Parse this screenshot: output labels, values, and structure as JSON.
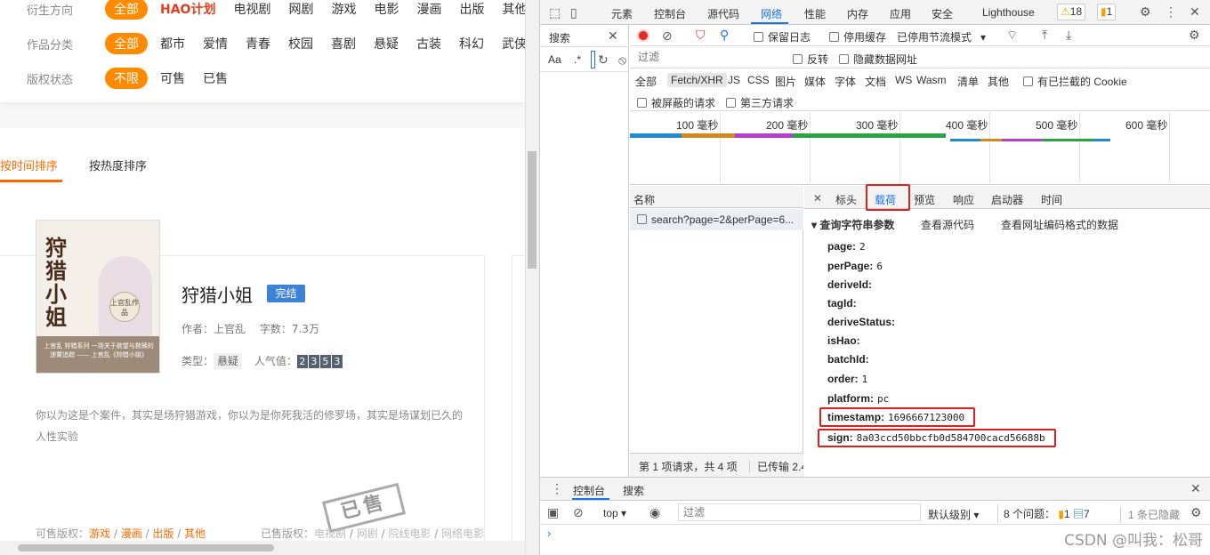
{
  "left": {
    "filters": [
      {
        "label": "衍生方向",
        "active": "全部",
        "hao": "HAO计划",
        "options": [
          "电视剧",
          "网剧",
          "游戏",
          "电影",
          "漫画",
          "出版",
          "其他"
        ]
      },
      {
        "label": "作品分类",
        "active": "全部",
        "options": [
          "都市",
          "爱情",
          "青春",
          "校园",
          "喜剧",
          "悬疑",
          "古装",
          "科幻",
          "武侠"
        ]
      },
      {
        "label": "版权状态",
        "active": "不限",
        "options": [
          "可售",
          "已售"
        ]
      }
    ],
    "sort": {
      "by_time": "按时间排序",
      "by_heat": "按热度排序"
    },
    "book": {
      "cover_title": "狩猎小姐",
      "cover_seal": "上官乱作品",
      "cover_band": "上官乱 狩猎系列 一场关于欲望与救赎的迷雾追踪 —— 上官乱《狩猎小姐》",
      "title": "狩猎小姐",
      "status": "完结",
      "author_label": "作者：",
      "author": "上官乱",
      "words_label": "字数：",
      "words": "7.3万",
      "type_label": "类型：",
      "type": "悬疑",
      "popularity_label": "人气值：",
      "popularity_digits": [
        "2",
        "3",
        "5",
        "3"
      ],
      "description": "你以为这是个案件，其实是场狩猎游戏，你以为是你死我活的修罗场，其实是场谋划已久的人性实验",
      "sellable_label": "可售版权：",
      "sellable": [
        "游戏",
        "漫画",
        "出版",
        "其他"
      ],
      "sold_label": "已售版权：",
      "sold": [
        "电视剧",
        "网剧",
        "院线电影",
        "网络电影"
      ],
      "stamp": "已售"
    }
  },
  "devtools": {
    "tabs": [
      "元素",
      "控制台",
      "源代码",
      "网络",
      "性能",
      "内存",
      "应用",
      "安全",
      "Lighthouse"
    ],
    "active_tab": "网络",
    "warnings": "18",
    "errors": "1",
    "search": {
      "title": "搜索",
      "aa": "Aa",
      "regex": ".*"
    },
    "toolbar": {
      "preserve_log": "保留日志",
      "disable_cache": "停用缓存",
      "throttle": "已停用节流模式"
    },
    "filter": {
      "placeholder": "过滤",
      "invert": "反转",
      "hide_data_urls": "隐藏数据网址"
    },
    "types": [
      "全部",
      "Fetch/XHR",
      "JS",
      "CSS",
      "图片",
      "媒体",
      "字体",
      "文档",
      "WS",
      "Wasm",
      "清单",
      "其他"
    ],
    "active_type": "Fetch/XHR",
    "blocked_cookies": "有已拦截的 Cookie",
    "blocked_requests": "被屏蔽的请求",
    "third_party": "第三方请求",
    "timeline_ticks": [
      "100 毫秒",
      "200 毫秒",
      "300 毫秒",
      "400 毫秒",
      "500 毫秒",
      "600 毫秒"
    ],
    "name_header": "名称",
    "request": "search?page=2&perPage=6...",
    "status": {
      "requests": "第 1 项请求，共 4 项",
      "transferred": "已传输 2.4"
    },
    "detail_tabs": [
      "标头",
      "载荷",
      "预览",
      "响应",
      "启动器",
      "时间"
    ],
    "active_detail_tab": "载荷",
    "section": "▾ 查询字符串参数",
    "view_source": "查看源代码",
    "view_encoded": "查看网址编码格式的数据",
    "params": [
      {
        "key": "page:",
        "value": "2"
      },
      {
        "key": "perPage:",
        "value": "6"
      },
      {
        "key": "deriveId:",
        "value": ""
      },
      {
        "key": "tagId:",
        "value": ""
      },
      {
        "key": "deriveStatus:",
        "value": ""
      },
      {
        "key": "isHao:",
        "value": ""
      },
      {
        "key": "batchId:",
        "value": ""
      },
      {
        "key": "order:",
        "value": "1"
      },
      {
        "key": "platform:",
        "value": "pc"
      },
      {
        "key": "timestamp:",
        "value": "1696667123000"
      },
      {
        "key": "sign:",
        "value": "8a03ccd50bbcfb0d584700cacd56688b"
      }
    ],
    "console": {
      "tab_console": "控制台",
      "tab_search": "搜索",
      "context": "top",
      "filter_placeholder": "过滤",
      "level": "默认级别",
      "issues_label": "8 个问题：",
      "issues_err": "1",
      "issues_msg": "7",
      "hidden": "1 条已隐藏"
    },
    "accent": "#1a73e8",
    "highlight": "#e01e1e"
  },
  "watermark": "CSDN @叫我：松哥"
}
